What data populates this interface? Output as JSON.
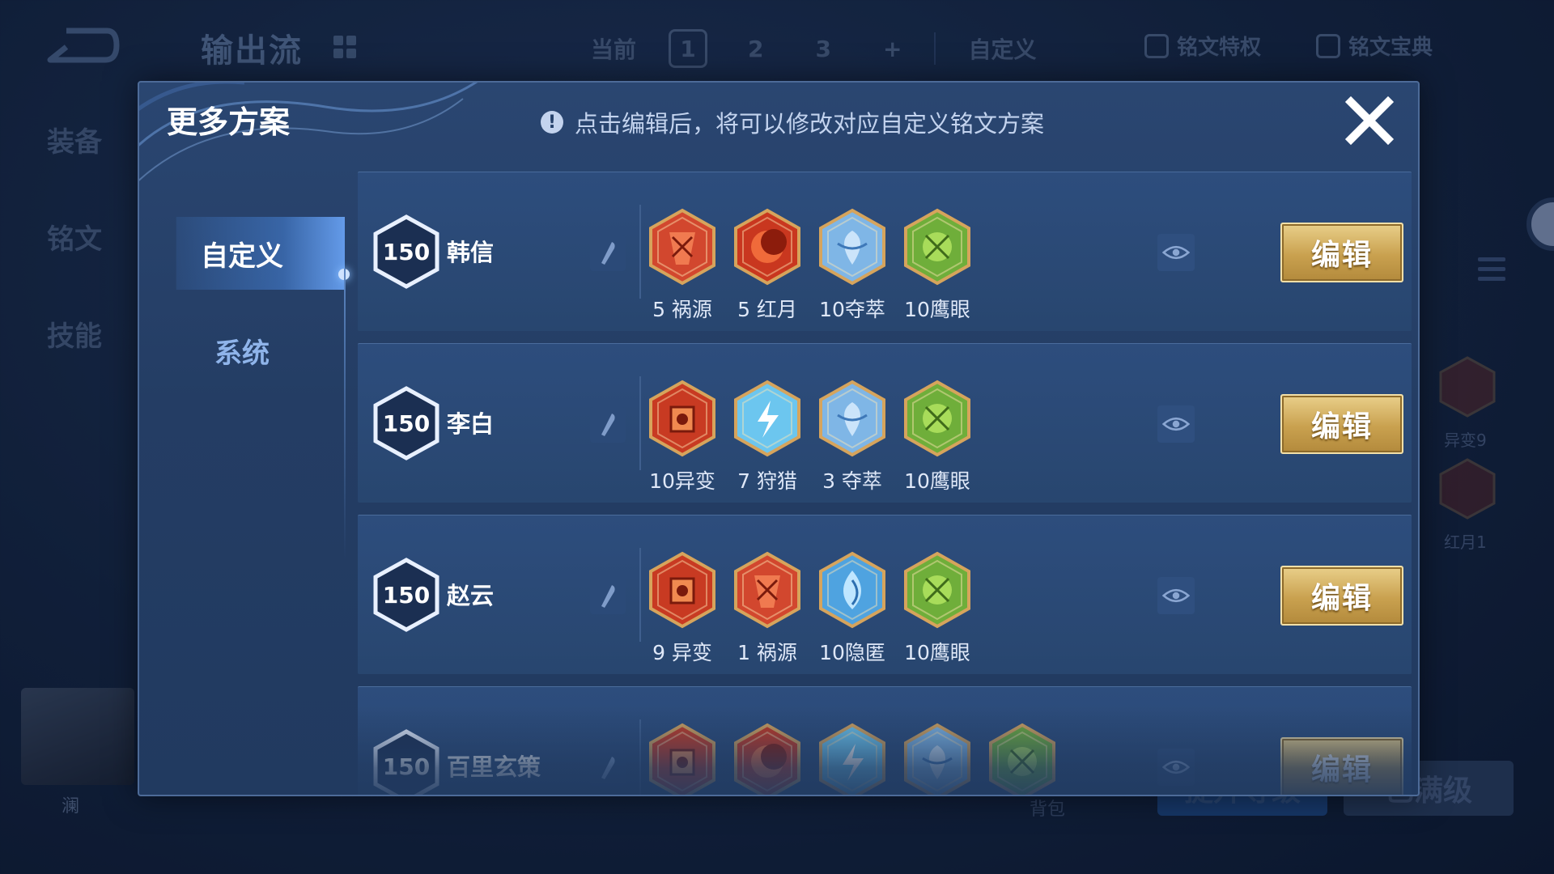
{
  "background": {
    "title": "输出流",
    "tabs": {
      "current": "当前",
      "pages": [
        "1",
        "2",
        "3"
      ],
      "add": "+",
      "custom": "自定义"
    },
    "links": {
      "privilege": "铭文特权",
      "codex": "铭文宝典"
    },
    "side_nav": [
      "装备",
      "铭文",
      "技能"
    ],
    "avatar_name": "澜",
    "bag_label": "背包",
    "btn_upgrade": "提升等级",
    "btn_maxed": "已满级",
    "right_labels": [
      "异变9",
      "红月1"
    ]
  },
  "modal": {
    "title": "更多方案",
    "hint_icon": "!",
    "hint": "点击编辑后，将可以修改对应自定义铭文方案",
    "nav": {
      "custom": "自定义",
      "system": "系统"
    },
    "edit_label": "编辑",
    "rows": [
      {
        "level": "150",
        "hero": "韩信",
        "gems": [
          {
            "type": "huoyuan",
            "label": "5 祸源"
          },
          {
            "type": "hongyue",
            "label": "5 红月"
          },
          {
            "type": "duocui",
            "label": "10夺萃"
          },
          {
            "type": "yingyan",
            "label": "10鹰眼"
          }
        ]
      },
      {
        "level": "150",
        "hero": "李白",
        "gems": [
          {
            "type": "yibian",
            "label": "10异变"
          },
          {
            "type": "shoulie",
            "label": "7 狩猎"
          },
          {
            "type": "duocui",
            "label": "3 夺萃"
          },
          {
            "type": "yingyan",
            "label": "10鹰眼"
          }
        ]
      },
      {
        "level": "150",
        "hero": "赵云",
        "gems": [
          {
            "type": "yibian",
            "label": "9 异变"
          },
          {
            "type": "huoyuan",
            "label": "1 祸源"
          },
          {
            "type": "yinni",
            "label": "10隐匿"
          },
          {
            "type": "yingyan",
            "label": "10鹰眼"
          }
        ]
      },
      {
        "level": "150",
        "hero": "百里玄策",
        "gems": [
          {
            "type": "yibian",
            "label": ""
          },
          {
            "type": "hongyue",
            "label": ""
          },
          {
            "type": "shoulie",
            "label": ""
          },
          {
            "type": "duocui",
            "label": ""
          },
          {
            "type": "yingyan",
            "label": ""
          }
        ]
      }
    ]
  },
  "colors": {
    "huoyuan": "#d2472e",
    "hongyue": "#c9371f",
    "yibian": "#c83a22",
    "duocui": "#7fb6e6",
    "shoulie": "#6cc6ef",
    "yinni": "#4fa3e0",
    "yingyan": "#6fae3a",
    "accent_gold": "#c9a14f"
  }
}
